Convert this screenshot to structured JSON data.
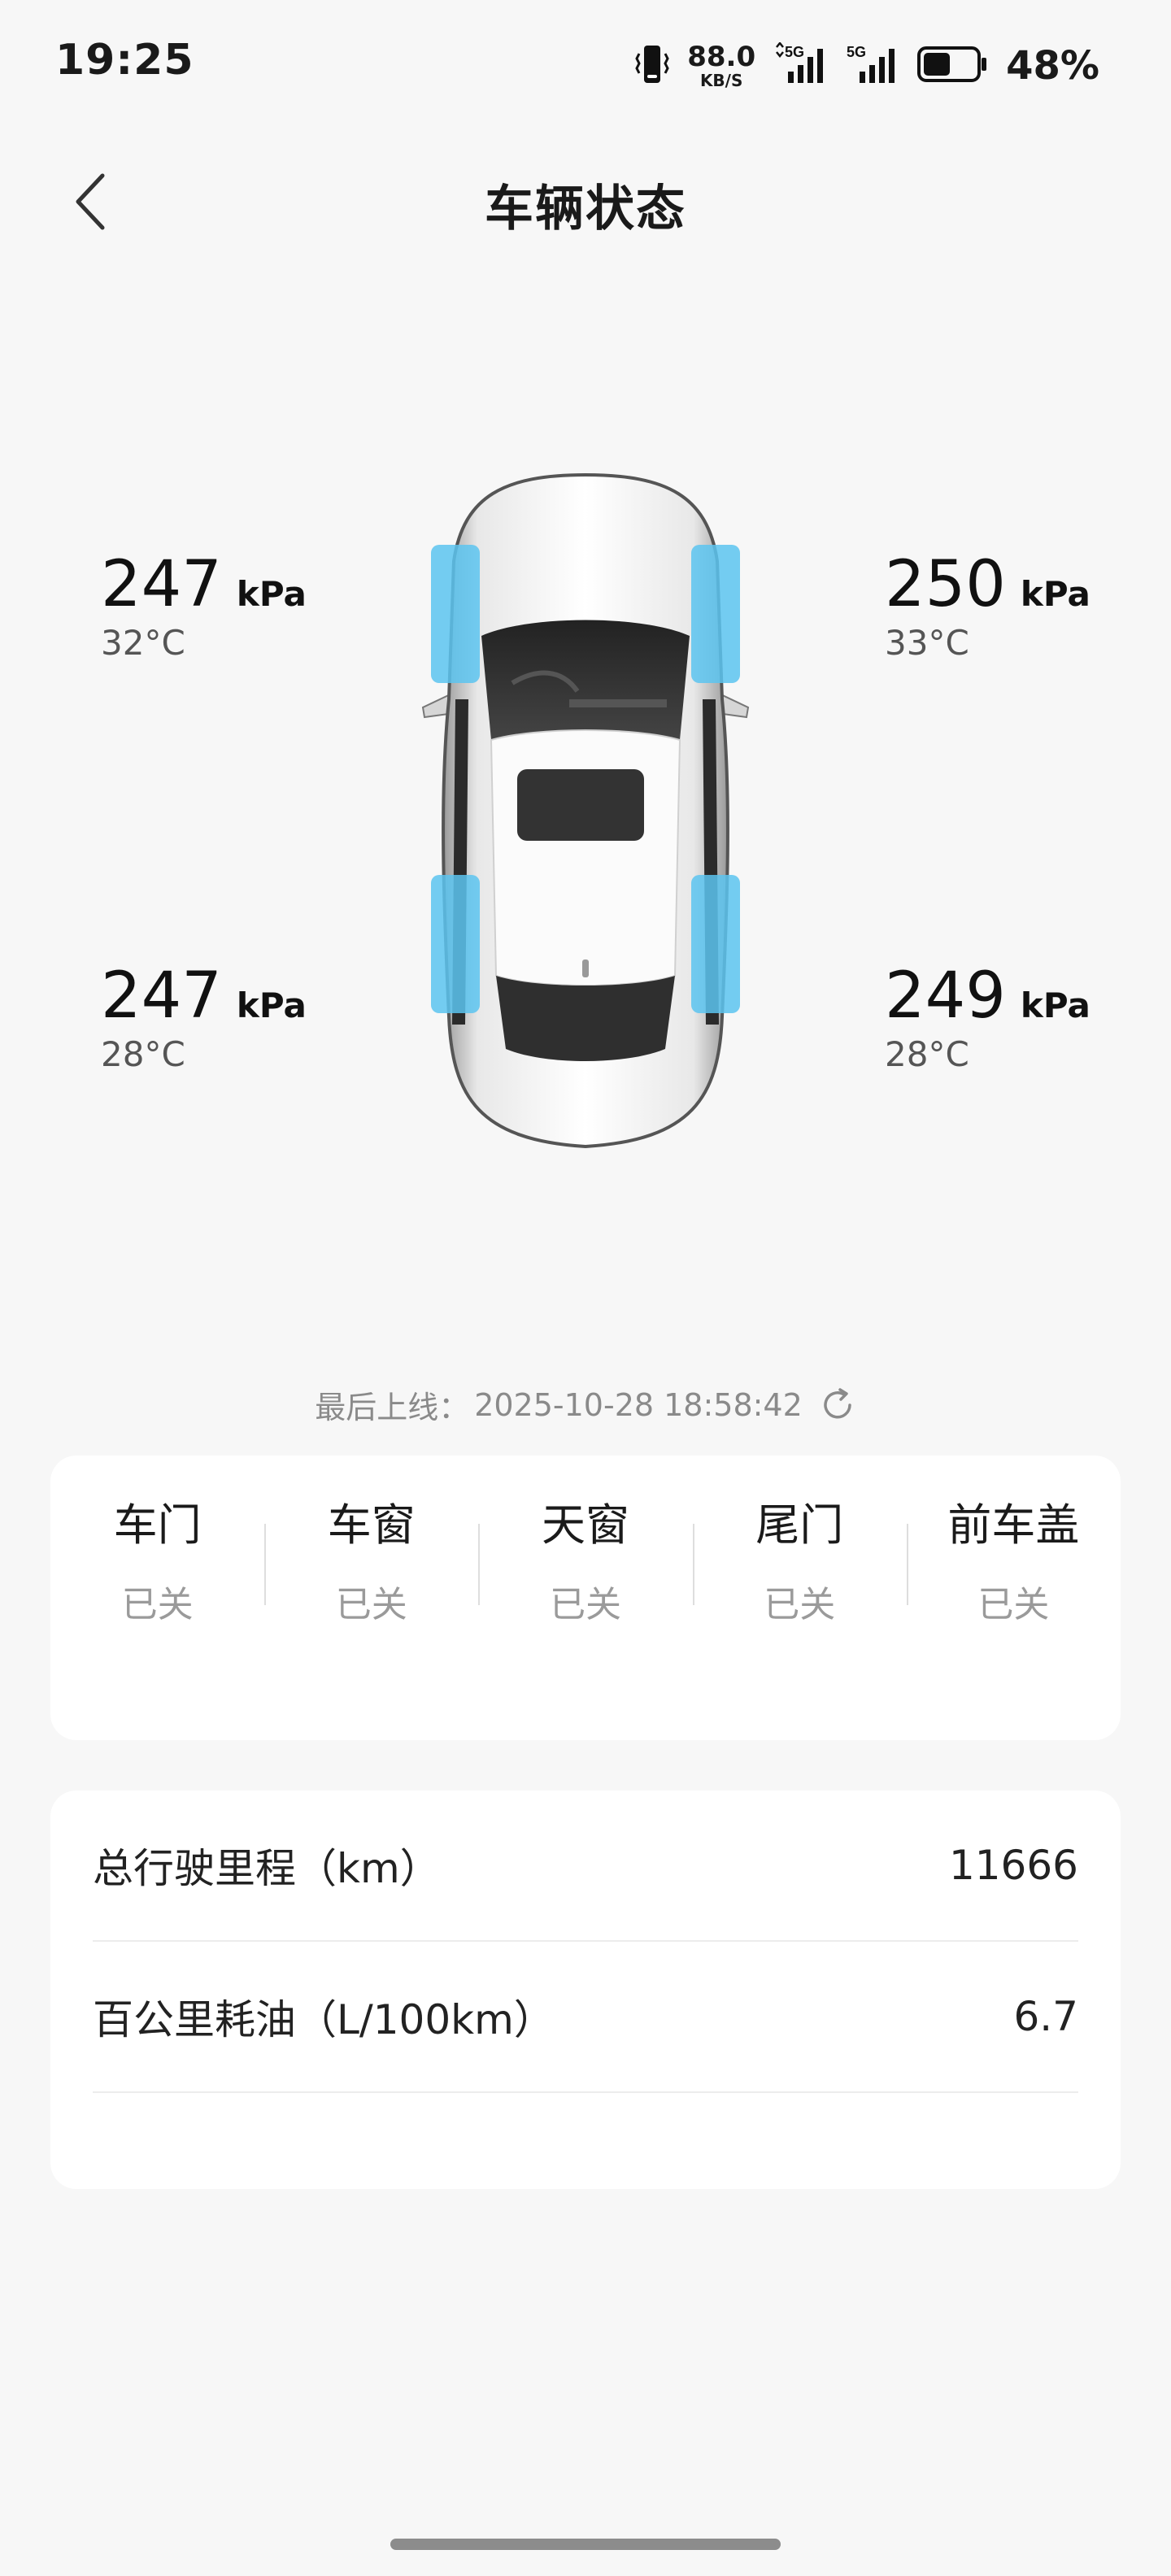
{
  "status_bar": {
    "time": "19:25",
    "net_speed_value": "88.0",
    "net_speed_unit": "KB/S",
    "signal_label": "5G",
    "battery_percent": "48%"
  },
  "header": {
    "title": "车辆状态",
    "back_icon": "chevron-left-icon"
  },
  "tires": {
    "front_left": {
      "pressure": "247",
      "unit": "kPa",
      "temp": "32°C"
    },
    "front_right": {
      "pressure": "250",
      "unit": "kPa",
      "temp": "33°C"
    },
    "rear_left": {
      "pressure": "247",
      "unit": "kPa",
      "temp": "28°C"
    },
    "rear_right": {
      "pressure": "249",
      "unit": "kPa",
      "temp": "28°C"
    }
  },
  "last_online": {
    "label": "最后上线：",
    "value": "2025-10-28 18:58:42",
    "icon": "refresh-icon"
  },
  "vehicle_status": {
    "items": [
      {
        "name": "车门",
        "state": "已关"
      },
      {
        "name": "车窗",
        "state": "已关"
      },
      {
        "name": "天窗",
        "state": "已关"
      },
      {
        "name": "尾门",
        "state": "已关"
      },
      {
        "name": "前车盖",
        "state": "已关"
      }
    ]
  },
  "stats": {
    "mileage": {
      "label": "总行驶里程（km）",
      "value": "11666"
    },
    "fuel": {
      "label": "百公里耗油（L/100km）",
      "value": "6.7"
    }
  },
  "colors": {
    "background": "#f7f7f7",
    "card": "#ffffff",
    "tire_highlight": "#5cc4f0",
    "text_primary": "#1a1a1a",
    "text_secondary": "#9a9a9a"
  }
}
